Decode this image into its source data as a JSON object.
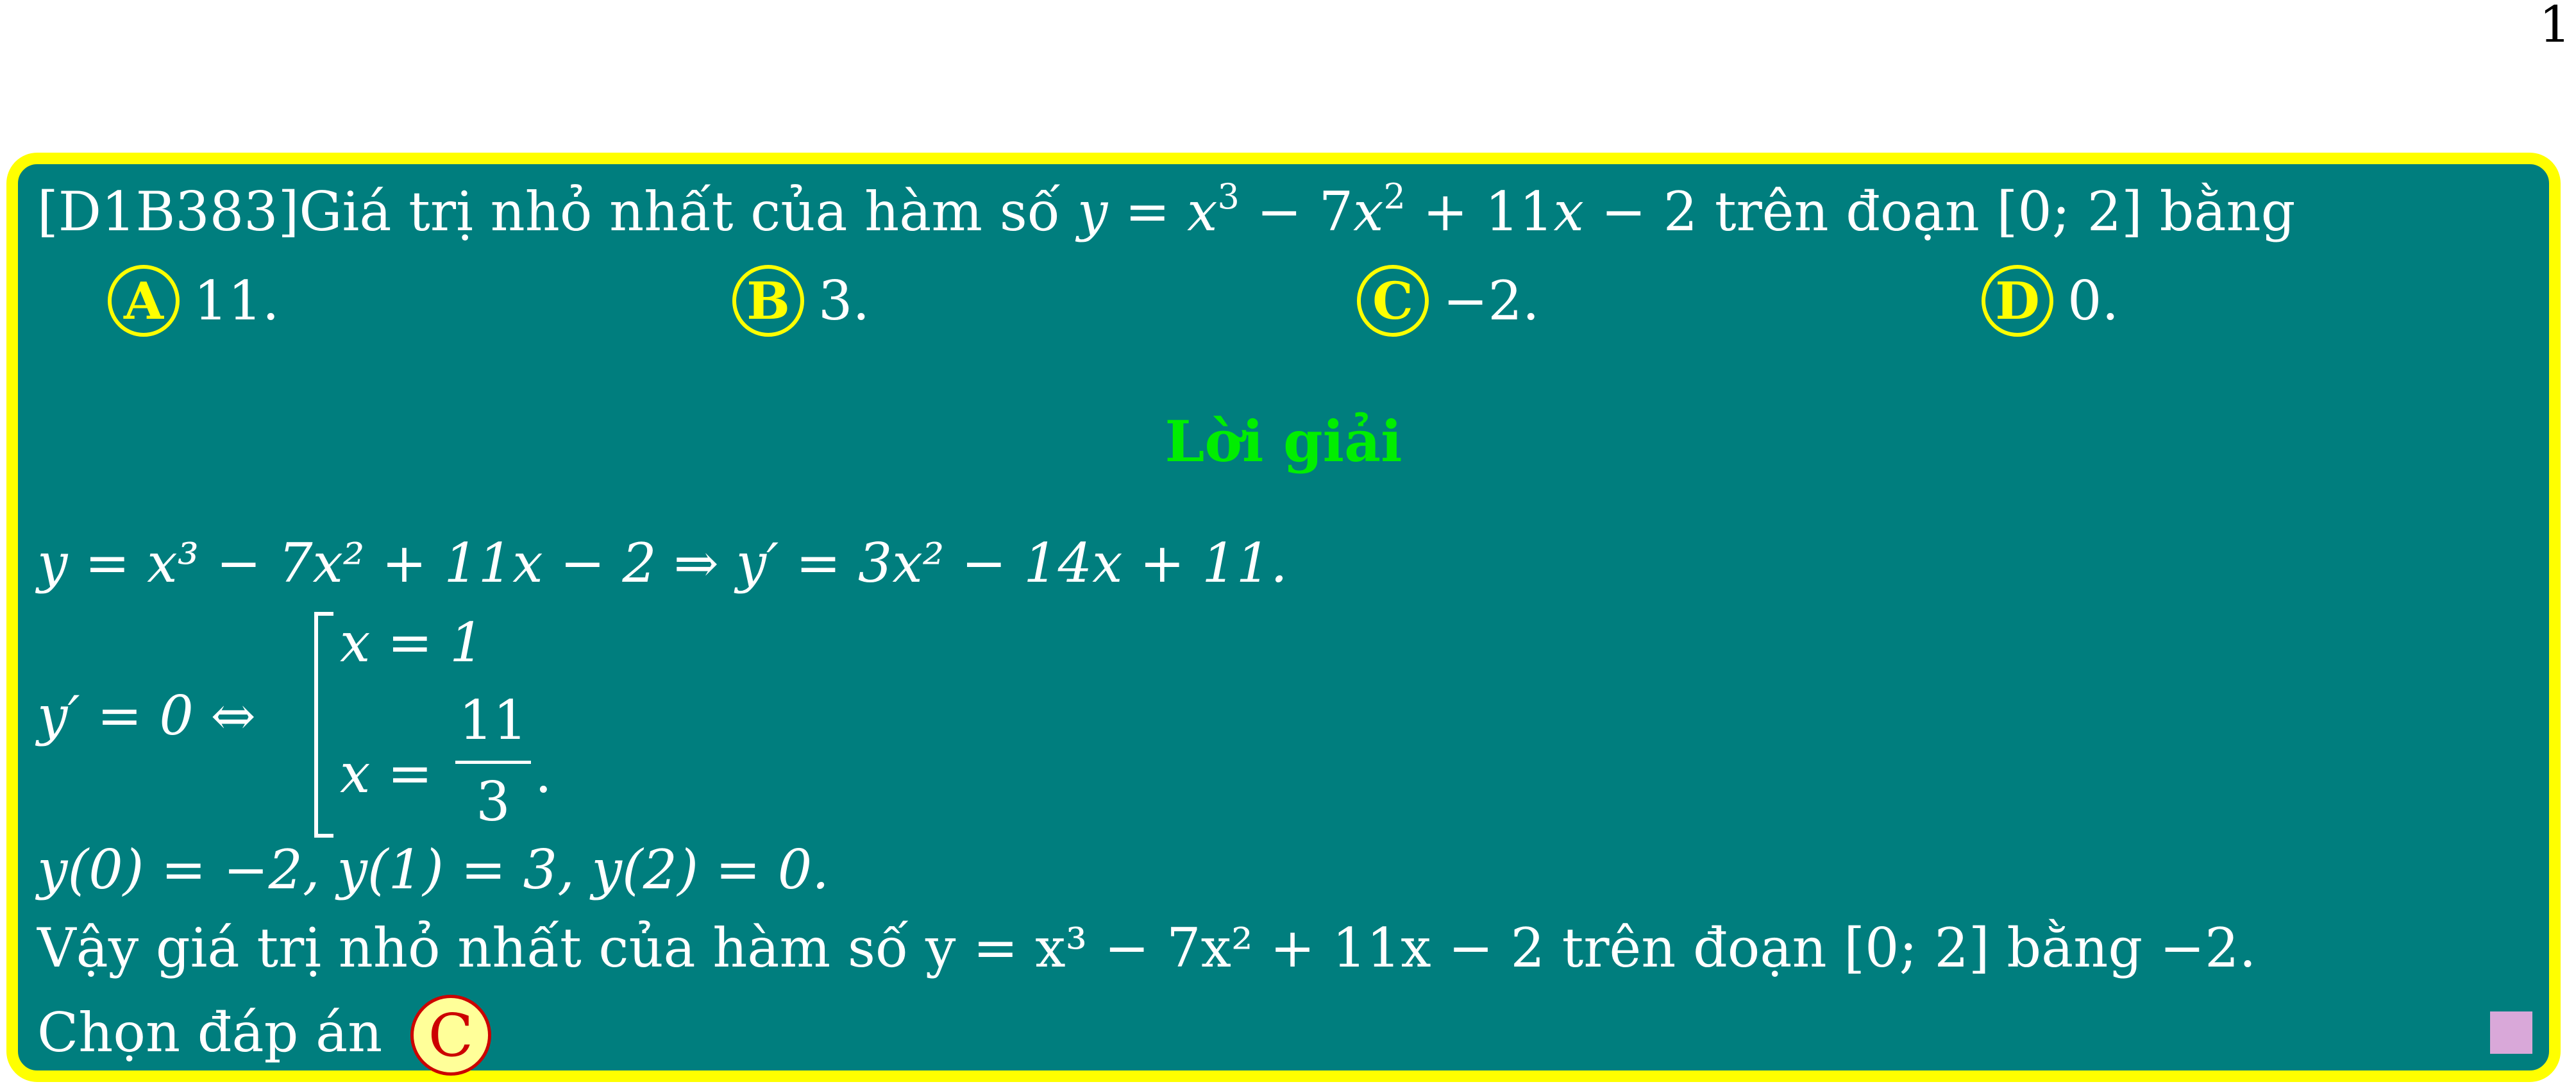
{
  "page_number": "1",
  "question": {
    "id": "[D1B383]",
    "stem_text": "Giá trị nhỏ nhất của hàm số",
    "function": "y = x³ − 7x² + 11x − 2",
    "stem_tail": "trên đoạn [0; 2] bằng"
  },
  "options": [
    {
      "letter": "A",
      "value": "11."
    },
    {
      "letter": "B",
      "value": "3."
    },
    {
      "letter": "C",
      "value": "−2."
    },
    {
      "letter": "D",
      "value": "0."
    }
  ],
  "solution": {
    "heading": "Lời giải",
    "line1": "y = x³ − 7x² + 11x − 2 ⇒ y′ = 3x² − 14x + 11.",
    "line2_lhs": "y′ = 0 ⇔",
    "root1": "x = 1",
    "root2_lhs": "x =",
    "root2_num": "11",
    "root2_den": "3",
    "line3": "y(0) = −2, y(1) = 3, y(2) = 0.",
    "line4": "Vậy giá trị nhỏ nhất của hàm số y = x³ − 7x² + 11x − 2 trên đoạn [0; 2] bằng −2.",
    "answer_prefix": "Chọn đáp án",
    "answer_letter": "C"
  },
  "colors": {
    "frame": "#ffff00",
    "background": "#007e7e",
    "heading": "#00ee00",
    "answer_badge": "#cc0000"
  }
}
